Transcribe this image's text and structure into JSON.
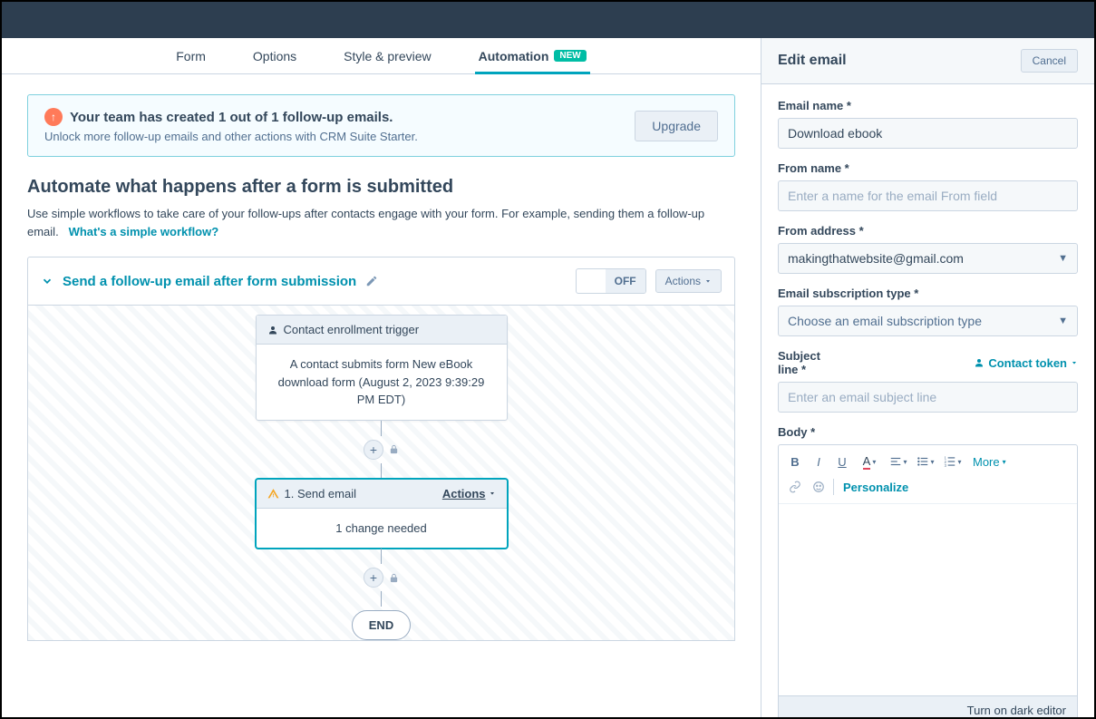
{
  "tabs": {
    "form": "Form",
    "options": "Options",
    "style": "Style & preview",
    "automation": "Automation",
    "new_badge": "NEW"
  },
  "banner": {
    "title": "Your team has created 1 out of 1 follow-up emails.",
    "subtitle": "Unlock more follow-up emails and other actions with CRM Suite Starter.",
    "upgrade": "Upgrade"
  },
  "section": {
    "title": "Automate what happens after a form is submitted",
    "subtitle": "Use simple workflows to take care of your follow-ups after contacts engage with your form. For example, sending them a follow-up email.",
    "link": "What's a simple workflow?"
  },
  "workflow": {
    "title": "Send a follow-up email after form submission",
    "toggle_off": "OFF",
    "actions": "Actions",
    "trigger_head": "Contact enrollment trigger",
    "trigger_body": "A contact submits form New eBook download form (August 2, 2023 9:39:29 PM EDT)",
    "step1_head": "1. Send email",
    "step1_actions": "Actions",
    "step1_body": "1 change needed",
    "end": "END"
  },
  "panel": {
    "title": "Edit email",
    "cancel": "Cancel",
    "email_name_label": "Email name *",
    "email_name_value": "Download ebook",
    "from_name_label": "From name *",
    "from_name_placeholder": "Enter a name for the email From field",
    "from_address_label": "From address *",
    "from_address_value": "makingthatwebsite@gmail.com",
    "sub_type_label": "Email subscription type *",
    "sub_type_value": "Choose an email subscription type",
    "subject_label": "Subject line *",
    "token_link": "Contact token",
    "subject_placeholder": "Enter an email subject line",
    "body_label": "Body *",
    "more": "More",
    "personalize": "Personalize",
    "dark": "Turn on dark editor"
  }
}
